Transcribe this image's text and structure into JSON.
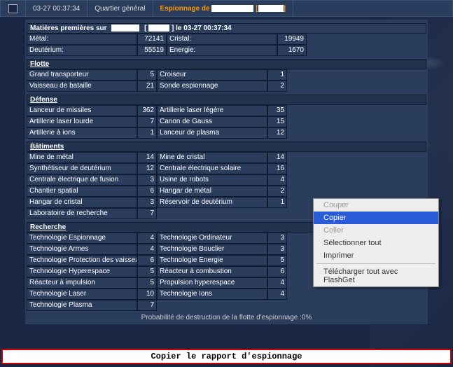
{
  "topbar": {
    "timestamp": "03-27 00:37:34",
    "location": "Quartier général",
    "spy_prefix": "Espionnage de",
    "bracket_open": "[",
    "bracket_close": "]"
  },
  "header": {
    "prefix": "Matières premières sur",
    "mid": "[",
    "mid2": "] le 03-27 00:37:34"
  },
  "resources": {
    "metal_l": "Métal:",
    "metal_v": "72141",
    "crystal_l": "Cristal:",
    "crystal_v": "19949",
    "deut_l": "Deutérium:",
    "deut_v": "55519",
    "energy_l": "Energie:",
    "energy_v": "1670"
  },
  "sections": {
    "fleet": "Flotte",
    "defense": "Défense",
    "buildings": "Bâtiments",
    "research": "Recherche"
  },
  "fleet": [
    {
      "l": "Grand transporteur",
      "v": "5",
      "l2": "Croiseur",
      "v2": "1"
    },
    {
      "l": "Vaisseau de bataille",
      "v": "21",
      "l2": "Sonde espionnage",
      "v2": "2"
    }
  ],
  "defense": [
    {
      "l": "Lanceur de missiles",
      "v": "362",
      "l2": "Artillerie laser légère",
      "v2": "35"
    },
    {
      "l": "Artillerie laser lourde",
      "v": "7",
      "l2": "Canon de Gauss",
      "v2": "15"
    },
    {
      "l": "Artillerie à ions",
      "v": "1",
      "l2": "Lanceur de plasma",
      "v2": "12"
    }
  ],
  "buildings": [
    {
      "l": "Mine de métal",
      "v": "14",
      "l2": "Mine de cristal",
      "v2": "14"
    },
    {
      "l": "Synthétiseur de deutérium",
      "v": "12",
      "l2": "Centrale électrique solaire",
      "v2": "16"
    },
    {
      "l": "Centrale électrique de fusion",
      "v": "3",
      "l2": "Usine de robots",
      "v2": "4"
    },
    {
      "l": "Chantier spatial",
      "v": "6",
      "l2": "Hangar de métal",
      "v2": "2"
    },
    {
      "l": "Hangar de cristal",
      "v": "3",
      "l2": "Réservoir de deutérium",
      "v2": "1"
    },
    {
      "l": "Laboratoire de recherche",
      "v": "7",
      "l2": "",
      "v2": ""
    }
  ],
  "research": [
    {
      "l": "Technologie Espionnage",
      "v": "4",
      "l2": "Technologie Ordinateur",
      "v2": "3"
    },
    {
      "l": "Technologie Armes",
      "v": "4",
      "l2": "Technologie Bouclier",
      "v2": "3"
    },
    {
      "l": "Technologie Protection des vaisseaux spatiaux",
      "v": "6",
      "l2": "Technologie Energie",
      "v2": "5"
    },
    {
      "l": "Technologie Hyperespace",
      "v": "5",
      "l2": "Réacteur à combustion",
      "v2": "6"
    },
    {
      "l": "Réacteur à impulsion",
      "v": "5",
      "l2": "Propulsion hyperespace",
      "v2": "4"
    },
    {
      "l": "Technologie Laser",
      "v": "10",
      "l2": "Technologie Ions",
      "v2": "4"
    },
    {
      "l": "Technologie Plasma",
      "v": "7",
      "l2": "",
      "v2": ""
    }
  ],
  "probability": "Probabilité de destruction de la flotte d'espionnage :0%",
  "copy_bar": "Copier le rapport d'espionnage",
  "ctx": {
    "cut": "Couper",
    "copy": "Copier",
    "paste": "Coller",
    "select_all": "Sélectionner tout",
    "print": "Imprimer",
    "flashget": "Télécharger tout avec FlashGet"
  }
}
